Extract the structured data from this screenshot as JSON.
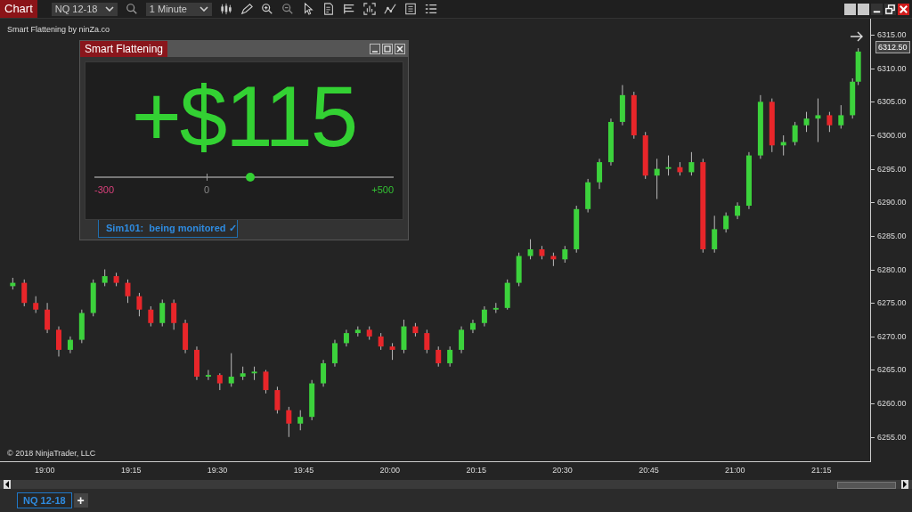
{
  "toolbar": {
    "title": "Chart",
    "instrument": "NQ 12-18",
    "interval": "1 Minute"
  },
  "chart": {
    "indicator_label": "Smart Flattening by ninZa.co",
    "copyright": "© 2018 NinjaTrader, LLC",
    "current_price": "6312.50",
    "chart_data": {
      "type": "candlestick",
      "xlim": [
        18.863,
        21.387
      ],
      "ylim": [
        6251.25,
        6317.4
      ],
      "x": [
        18.9,
        18.9333,
        18.9667,
        19,
        19.0333,
        19.0667,
        19.1,
        19.1333,
        19.1667,
        19.2,
        19.2333,
        19.2667,
        19.3,
        19.3333,
        19.3667,
        19.4,
        19.4333,
        19.4667,
        19.5,
        19.5333,
        19.5667,
        19.6,
        19.6333,
        19.6667,
        19.7,
        19.7333,
        19.7667,
        19.8,
        19.8333,
        19.8667,
        19.9,
        19.9333,
        19.9667,
        20,
        20.0333,
        20.0667,
        20.1,
        20.1333,
        20.1667,
        20.2,
        20.2333,
        20.2667,
        20.3,
        20.3333,
        20.3667,
        20.4,
        20.4333,
        20.4667,
        20.5,
        20.5333,
        20.5667,
        20.6,
        20.6333,
        20.6667,
        20.7,
        20.7333,
        20.7667,
        20.8,
        20.8333,
        20.8667,
        20.9,
        20.9333,
        20.9667,
        21,
        21.0333,
        21.0667,
        21.1,
        21.1333,
        21.1667,
        21.2,
        21.2333,
        21.2667,
        21.3,
        21.3333,
        21.35
      ],
      "ohlc": [
        [
          6277.5,
          6278.75,
          6277,
          6278
        ],
        [
          6278,
          6278.5,
          6274.5,
          6275
        ],
        [
          6275,
          6276,
          6273.5,
          6274
        ],
        [
          6274,
          6275,
          6270.5,
          6271
        ],
        [
          6271,
          6271.5,
          6267,
          6268
        ],
        [
          6268,
          6270,
          6267.5,
          6269.5
        ],
        [
          6269.5,
          6274,
          6269,
          6273.5
        ],
        [
          6273.5,
          6278.5,
          6273,
          6278
        ],
        [
          6278,
          6280,
          6277.5,
          6279
        ],
        [
          6279,
          6279.5,
          6277.5,
          6278
        ],
        [
          6278,
          6278.5,
          6275,
          6276
        ],
        [
          6276,
          6276.5,
          6273,
          6274
        ],
        [
          6274,
          6274.5,
          6271.5,
          6272
        ],
        [
          6272,
          6275.5,
          6271.5,
          6275
        ],
        [
          6275,
          6275.5,
          6271,
          6272
        ],
        [
          6272,
          6272.5,
          6267.5,
          6268
        ],
        [
          6268,
          6268.5,
          6263.5,
          6264
        ],
        [
          6264,
          6265,
          6263.5,
          6264.25
        ],
        [
          6264.25,
          6264.5,
          6262,
          6263
        ],
        [
          6263,
          6267.5,
          6262.5,
          6264
        ],
        [
          6264,
          6265.5,
          6263.5,
          6264.5
        ],
        [
          6264.5,
          6265.5,
          6263.5,
          6264.75
        ],
        [
          6264.75,
          6265,
          6261.5,
          6262
        ],
        [
          6262,
          6262.5,
          6258.5,
          6259
        ],
        [
          6259,
          6259.5,
          6255,
          6257
        ],
        [
          6257,
          6259,
          6256,
          6258
        ],
        [
          6258,
          6263.5,
          6257.5,
          6263
        ],
        [
          6263,
          6266.5,
          6262.5,
          6266
        ],
        [
          6266,
          6269.5,
          6265.5,
          6269
        ],
        [
          6269,
          6271,
          6268.5,
          6270.5
        ],
        [
          6270.5,
          6271.5,
          6270,
          6271
        ],
        [
          6271,
          6271.5,
          6269.5,
          6270
        ],
        [
          6270,
          6270.5,
          6268,
          6268.5
        ],
        [
          6268.5,
          6269,
          6266.5,
          6268
        ],
        [
          6268,
          6272.5,
          6267.5,
          6271.5
        ],
        [
          6271.5,
          6272,
          6270,
          6270.5
        ],
        [
          6270.5,
          6271,
          6267.5,
          6268
        ],
        [
          6268,
          6268.5,
          6265.5,
          6266
        ],
        [
          6266,
          6268.5,
          6265.5,
          6268
        ],
        [
          6268,
          6271.5,
          6267.5,
          6271
        ],
        [
          6271,
          6272.5,
          6270.5,
          6272
        ],
        [
          6272,
          6274.5,
          6271.5,
          6274
        ],
        [
          6274,
          6275,
          6273.5,
          6274.25
        ],
        [
          6274.25,
          6278.5,
          6274,
          6278
        ],
        [
          6278,
          6282.5,
          6277.5,
          6282
        ],
        [
          6282,
          6284.5,
          6281.5,
          6283
        ],
        [
          6283,
          6283.5,
          6281.5,
          6282
        ],
        [
          6282,
          6282.5,
          6280.5,
          6281.5
        ],
        [
          6281.5,
          6283.5,
          6281,
          6283
        ],
        [
          6283,
          6289.5,
          6282.5,
          6289
        ],
        [
          6289,
          6293.5,
          6288.5,
          6293
        ],
        [
          6293,
          6296.5,
          6292,
          6296
        ],
        [
          6296,
          6302.5,
          6295.5,
          6302
        ],
        [
          6302,
          6307.5,
          6301.5,
          6306
        ],
        [
          6306,
          6306.5,
          6299.5,
          6300
        ],
        [
          6300,
          6300.5,
          6293.5,
          6294
        ],
        [
          6294,
          6296.5,
          6290.5,
          6295
        ],
        [
          6295,
          6297,
          6294,
          6295.25
        ],
        [
          6295.25,
          6296,
          6294,
          6294.5
        ],
        [
          6294.5,
          6297.5,
          6294,
          6296
        ],
        [
          6296,
          6296.5,
          6282.5,
          6283
        ],
        [
          6283,
          6288,
          6282.5,
          6286
        ],
        [
          6286,
          6288.5,
          6285.5,
          6288
        ],
        [
          6288,
          6290,
          6287.5,
          6289.5
        ],
        [
          6289.5,
          6297.5,
          6289,
          6297
        ],
        [
          6297,
          6306,
          6296.5,
          6305
        ],
        [
          6305,
          6305.5,
          6297.5,
          6298.5
        ],
        [
          6298.5,
          6300,
          6297,
          6299
        ],
        [
          6299,
          6302,
          6298.5,
          6301.5
        ],
        [
          6301.5,
          6303.5,
          6300.5,
          6302.5
        ],
        [
          6302.5,
          6305.5,
          6299,
          6303
        ],
        [
          6303,
          6303.5,
          6300.5,
          6301.5
        ],
        [
          6301.5,
          6304.5,
          6301,
          6303
        ],
        [
          6303,
          6308.5,
          6302.5,
          6308
        ],
        [
          6308,
          6313,
          6307.5,
          6312.5
        ]
      ],
      "xticks": [
        {
          "value": 19,
          "label": "19:00"
        },
        {
          "value": 19.25,
          "label": "19:15"
        },
        {
          "value": 19.5,
          "label": "19:30"
        },
        {
          "value": 19.75,
          "label": "19:45"
        },
        {
          "value": 20,
          "label": "20:00"
        },
        {
          "value": 20.25,
          "label": "20:15"
        },
        {
          "value": 20.5,
          "label": "20:30"
        },
        {
          "value": 20.75,
          "label": "20:45"
        },
        {
          "value": 21,
          "label": "21:00"
        },
        {
          "value": 21.25,
          "label": "21:15"
        }
      ],
      "yticks": [
        {
          "value": 6315,
          "label": "6315.00"
        },
        {
          "value": 6310,
          "label": "6310.00"
        },
        {
          "value": 6305,
          "label": "6305.00"
        },
        {
          "value": 6300,
          "label": "6300.00"
        },
        {
          "value": 6295,
          "label": "6295.00"
        },
        {
          "value": 6290,
          "label": "6290.00"
        },
        {
          "value": 6285,
          "label": "6285.00"
        },
        {
          "value": 6280,
          "label": "6280.00"
        },
        {
          "value": 6275,
          "label": "6275.00"
        },
        {
          "value": 6270,
          "label": "6270.00"
        },
        {
          "value": 6265,
          "label": "6265.00"
        },
        {
          "value": 6260,
          "label": "6260.00"
        },
        {
          "value": 6255,
          "label": "6255.00"
        }
      ]
    }
  },
  "panel": {
    "title": "Smart Flattening",
    "pnl": "+$115",
    "slider": {
      "level": 0.52,
      "min": "-300",
      "mid": "0",
      "max": "+500"
    },
    "status": "Sim101:  being monitored ✓"
  },
  "tabs": [
    {
      "label": "NQ 12-18",
      "selected": true
    }
  ],
  "add_tab": "+"
}
